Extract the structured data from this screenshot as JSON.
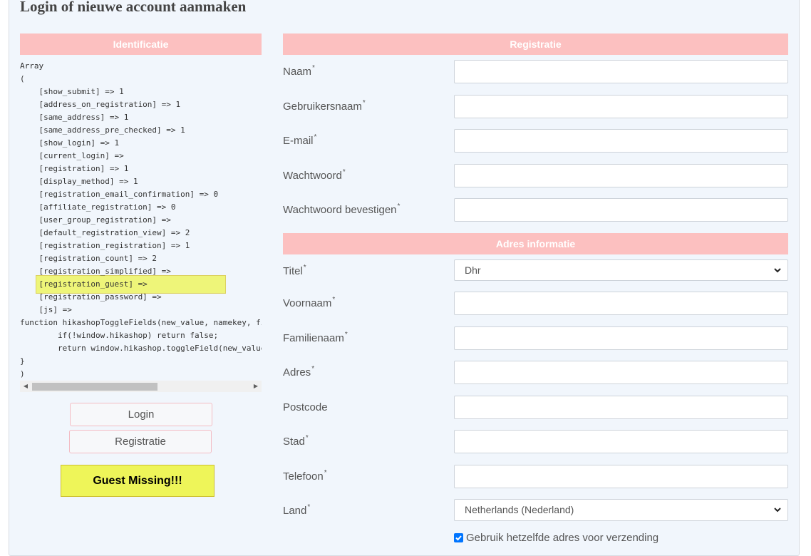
{
  "page": {
    "title": "Login of nieuwe account aanmaken"
  },
  "identificatie": {
    "header": "Identificatie",
    "debug_lines": [
      "Array",
      "(",
      "    [show_submit] => 1",
      "    [address_on_registration] => 1",
      "    [same_address] => 1",
      "    [same_address_pre_checked] => 1",
      "    [show_login] => 1",
      "    [current_login] =>",
      "    [registration] => 1",
      "    [display_method] => 1",
      "    [registration_email_confirmation] => 0",
      "    [affiliate_registration] => 0",
      "    [user_group_registration] =>",
      "    [default_registration_view] => 2",
      "    [registration_registration] => 1",
      "    [registration_count] => 2",
      "    [registration_simplified] =>",
      "    [registration_guest] =>",
      "    [registration_password] =>",
      "    [js] =>",
      "function hikashopToggleFields(new_value, namekey, field_type, id, prefix) {",
      "        if(!window.hikashop) return false;",
      "        return window.hikashop.toggleField(new_value, namekey, field_type, id, prefix);",
      "}",
      ")"
    ],
    "login_label": "Login",
    "registratie_label": "Registratie",
    "annotation": "Guest Missing!!!"
  },
  "registratie": {
    "header": "Registratie",
    "required_mark": "*",
    "fields": [
      {
        "label": "Naam",
        "value": ""
      },
      {
        "label": "Gebruikersnaam",
        "value": ""
      },
      {
        "label": "E-mail",
        "value": ""
      },
      {
        "label": "Wachtwoord",
        "value": ""
      },
      {
        "label": "Wachtwoord bevestigen",
        "value": ""
      }
    ]
  },
  "adres": {
    "header": "Adres informatie",
    "titel": {
      "label": "Titel",
      "selected": "Dhr"
    },
    "fields": [
      {
        "label": "Voornaam",
        "value": ""
      },
      {
        "label": "Familienaam",
        "value": ""
      },
      {
        "label": "Adres",
        "value": ""
      },
      {
        "label": "Postcode",
        "value": ""
      },
      {
        "label": "Stad",
        "value": ""
      },
      {
        "label": "Telefoon",
        "value": ""
      }
    ],
    "land": {
      "label": "Land",
      "selected": "Netherlands (Nederland)"
    },
    "same_address_label": "Gebruik hetzelfde adres voor verzending",
    "same_address_checked": true
  },
  "colors": {
    "section_header": "#fcc0c0",
    "highlight": "#eef559",
    "checkbox": "#0075ff"
  }
}
